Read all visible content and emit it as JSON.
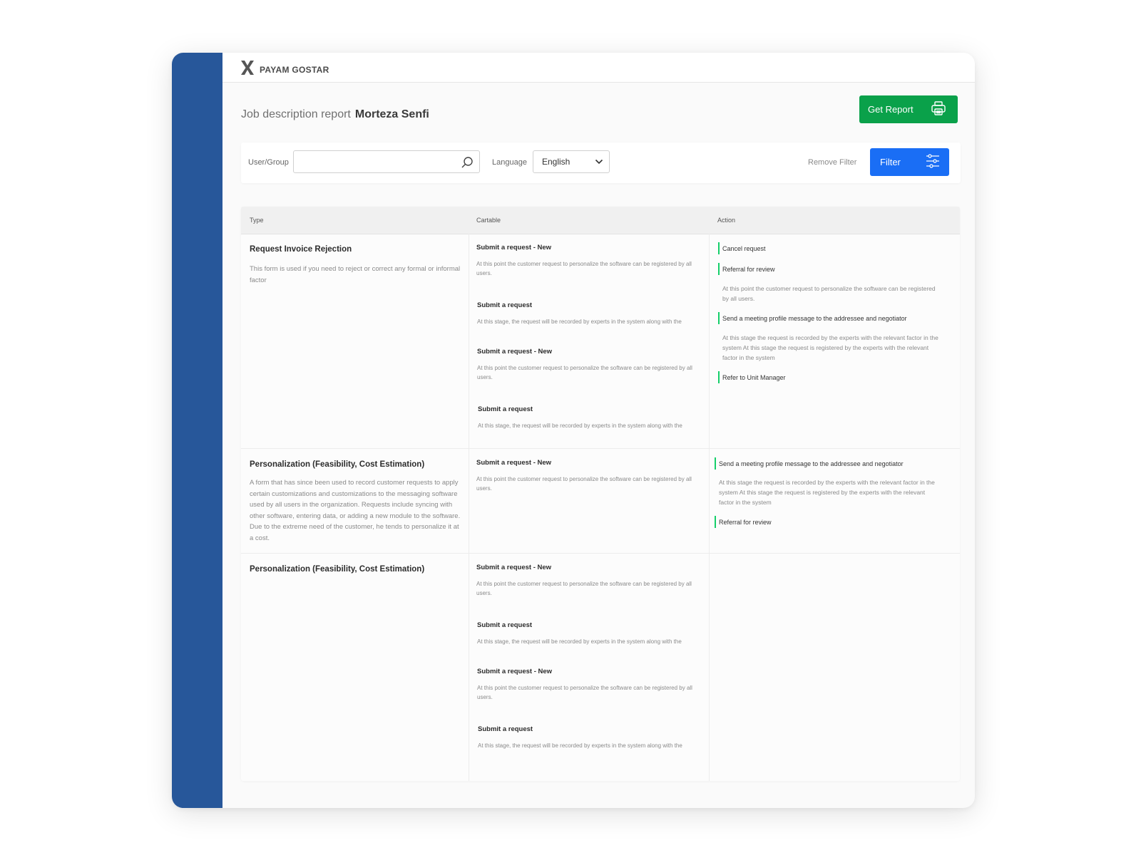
{
  "brand": {
    "logo_text": "PAYAM GOSTAR"
  },
  "header": {
    "title": "Job description report",
    "user_name": "Morteza Senfi"
  },
  "actions": {
    "get_report_label": "Get Report"
  },
  "filters": {
    "user_group_label": "User/Group",
    "search_value": "",
    "language_label": "Language",
    "language_value": "English",
    "remove_filter_label": "Remove Filter",
    "filter_label": "Filter"
  },
  "table": {
    "columns": [
      "Type",
      "Cartable",
      "Action"
    ],
    "rows": [
      {
        "type_title": "Request Invoice Rejection",
        "type_desc": "This form is used if you need to reject or correct any formal or informal factor",
        "cartable": [
          {
            "title": "Submit a request - New",
            "desc": "At this point the customer request to personalize the software can be registered by all users."
          },
          {
            "title": "Submit a request",
            "desc": "At this stage, the request will be recorded by experts in the system along with the"
          },
          {
            "title": "Submit a request - New",
            "desc": "At this point the customer request to personalize the software can be registered by all users."
          },
          {
            "title": "Submit a request",
            "desc": "At this stage, the request will be recorded by experts in the system along with the"
          }
        ],
        "actions": [
          {
            "label": "Cancel request",
            "desc": ""
          },
          {
            "label": "Referral for review",
            "desc": "At this point the customer request to personalize the software can be registered by all users."
          },
          {
            "label": "Send a meeting profile message to the addressee and negotiator",
            "desc": "At this stage the request is recorded by the experts with the relevant factor in the system At this stage the request is registered by the experts with the relevant factor in the system"
          },
          {
            "label": "Refer to Unit Manager",
            "desc": ""
          }
        ]
      },
      {
        "type_title": "Personalization (Feasibility, Cost Estimation)",
        "type_desc": "A form that has since been used to record customer requests to apply certain customizations and customizations to the messaging software used by all users in the organization. Requests include syncing with other software, entering data, or adding a new module to the software. Due to the extreme need of the customer, he tends to personalize it at a cost.",
        "cartable": [
          {
            "title": "Submit a request - New",
            "desc": "At this point the customer request to personalize the software can be registered by all users."
          }
        ],
        "actions": [
          {
            "label": "Send a meeting profile message to the addressee and negotiator",
            "desc": "At this stage the request is recorded by the experts with the relevant factor in the system At this stage the request is registered by the experts with the relevant factor in the system"
          },
          {
            "label": "Referral for review",
            "desc": ""
          }
        ]
      },
      {
        "type_title": "Personalization (Feasibility, Cost Estimation)",
        "type_desc": "",
        "cartable": [
          {
            "title": "Submit a request - New",
            "desc": "At this point the customer request to personalize the software can be registered by all users."
          },
          {
            "title": "Submit a request",
            "desc": "At this stage, the request will be recorded by experts in the system along with the"
          },
          {
            "title": "Submit a request - New",
            "desc": "At this point the customer request to personalize the software can be registered by all users."
          },
          {
            "title": "Submit a request",
            "desc": "At this stage, the request will be recorded by experts in the system along with the"
          }
        ],
        "actions": []
      }
    ]
  },
  "colors": {
    "sidebar": "#27579a",
    "report_button": "#0aa14a",
    "filter_button": "#1a6ef5",
    "action_marker": "#15cf6a"
  },
  "icons": {
    "logo": "payam-gostar-logo-icon",
    "report": "printer-icon",
    "search": "search-icon",
    "dropdown": "chevron-down-icon",
    "filter": "sliders-icon"
  }
}
